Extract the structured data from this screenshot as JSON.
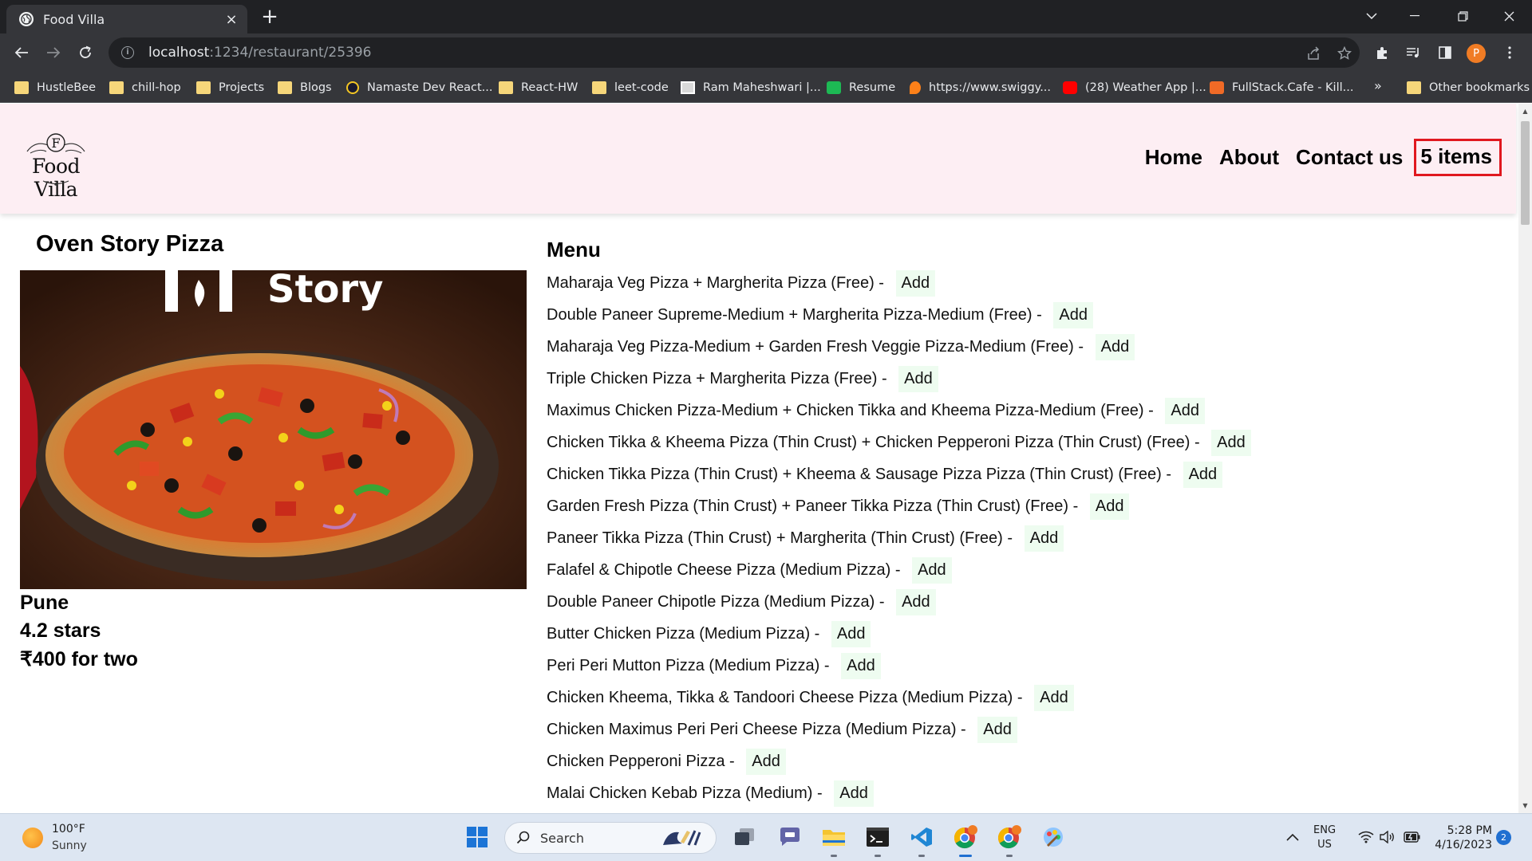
{
  "browser": {
    "tab_title": "Food Villa",
    "tab_close": "×",
    "new_tab": "+",
    "url_host": "localhost",
    "url_path": ":1234/restaurant/25396",
    "profile_initial": "P",
    "bookmarks": [
      {
        "label": "HustleBee",
        "icon": "folder-icon"
      },
      {
        "label": "chill-hop",
        "icon": "folder-icon"
      },
      {
        "label": "Projects",
        "icon": "folder-icon"
      },
      {
        "label": "Blogs",
        "icon": "folder-icon"
      },
      {
        "label": "Namaste Dev React...",
        "icon": "namaste-dev-icon"
      },
      {
        "label": "React-HW",
        "icon": "folder-icon"
      },
      {
        "label": "leet-code",
        "icon": "folder-icon"
      },
      {
        "label": "Ram Maheshwari |...",
        "icon": "profile-photo-icon"
      },
      {
        "label": "Resume",
        "icon": "resume-site-icon"
      },
      {
        "label": "https://www.swiggy...",
        "icon": "swiggy-icon"
      },
      {
        "label": "(28) Weather App |...",
        "icon": "youtube-icon"
      },
      {
        "label": "FullStack.Cafe - Kill...",
        "icon": "fullstack-cafe-icon"
      }
    ],
    "bookmarks_overflow": "»",
    "other_bookmarks": "Other bookmarks"
  },
  "site": {
    "logo_text": "Food Villa",
    "logo_monogram": "F",
    "nav": {
      "home": "Home",
      "about": "About",
      "contact": "Contact us",
      "cart": "5 items"
    }
  },
  "restaurant": {
    "name": "Oven Story Pizza",
    "image_banner_text": "Story",
    "city": "Pune",
    "rating": "4.2 stars",
    "cost": "₹400 for two"
  },
  "menu": {
    "heading": "Menu",
    "add_label": "Add",
    "items": [
      "Maharaja Veg Pizza + Margherita Pizza (Free) - ",
      "Double Paneer Supreme-Medium + Margherita Pizza-Medium (Free) - ",
      "Maharaja Veg Pizza-Medium + Garden Fresh Veggie Pizza-Medium (Free) - ",
      "Triple Chicken Pizza + Margherita Pizza (Free) - ",
      "Maximus Chicken Pizza-Medium + Chicken Tikka and Kheema Pizza-Medium (Free) - ",
      "Chicken Tikka & Kheema Pizza (Thin Crust) + Chicken Pepperoni Pizza (Thin Crust) (Free) - ",
      "Chicken Tikka Pizza (Thin Crust) + Kheema & Sausage Pizza Pizza (Thin Crust) (Free) - ",
      "Garden Fresh Pizza (Thin Crust) + Paneer Tikka Pizza (Thin Crust) (Free) - ",
      "Paneer Tikka Pizza (Thin Crust) + Margherita (Thin Crust) (Free) - ",
      "Falafel & Chipotle Cheese Pizza (Medium Pizza) - ",
      "Double Paneer Chipotle Pizza (Medium Pizza) - ",
      "Butter Chicken Pizza (Medium Pizza) - ",
      "Peri Peri Mutton Pizza (Medium Pizza) - ",
      "Chicken Kheema, Tikka & Tandoori Cheese Pizza (Medium Pizza) - ",
      "Chicken Maximus Peri Peri Cheese Pizza (Medium Pizza) - ",
      "Chicken Pepperoni Pizza - ",
      "Malai Chicken Kebab Pizza (Medium) - "
    ]
  },
  "taskbar": {
    "weather_temp": "100°F",
    "weather_desc": "Sunny",
    "search_label": "Search",
    "lang_line1": "ENG",
    "lang_line2": "US",
    "time": "5:28 PM",
    "date": "4/16/2023",
    "notification_count": "2"
  },
  "colors": {
    "header_bg": "#fdeef3",
    "cart_border": "#e0181f",
    "add_button_bg": "#eefcf0",
    "chrome_dark": "#202124",
    "chrome_toolbar": "#35363a"
  }
}
